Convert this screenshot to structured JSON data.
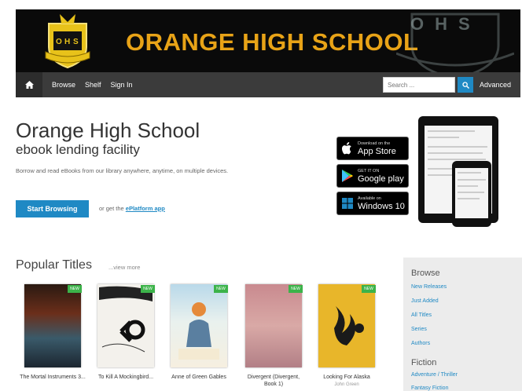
{
  "banner": {
    "title": "ORANGE HIGH SCHOOL",
    "watermark": "OHS",
    "crest_letters": [
      "O",
      "H",
      "S"
    ]
  },
  "nav": {
    "items": [
      "Browse",
      "Shelf",
      "Sign In"
    ],
    "search_placeholder": "Search ...",
    "advanced": "Advanced"
  },
  "hero": {
    "title": "Orange High School",
    "subtitle": "ebook lending facility",
    "description": "Borrow and read eBooks from our library anywhere, anytime, on multiple devices.",
    "button": "Start Browsing",
    "or_get_prefix": "or get the",
    "or_get_link": "ePlatform app"
  },
  "badges": [
    {
      "small": "Download on the",
      "large": "App Store",
      "icon": "apple-icon"
    },
    {
      "small": "GET IT ON",
      "large": "Google play",
      "icon": "google-play-icon"
    },
    {
      "small": "Available on",
      "large": "Windows 10",
      "icon": "windows-icon"
    }
  ],
  "popular": {
    "heading": "Popular Titles",
    "view_more": "...view more",
    "new_label": "NEW",
    "books": [
      {
        "title": "The Mortal Instruments 3...",
        "author": ""
      },
      {
        "title": "To Kill A Mockingbird...",
        "author": ""
      },
      {
        "title": "Anne of Green Gables",
        "author": ""
      },
      {
        "title": "Divergent (Divergent, Book 1)",
        "author": ""
      },
      {
        "title": "Looking For Alaska",
        "author": "John Green"
      }
    ]
  },
  "sidebar": {
    "browse_heading": "Browse",
    "browse_links": [
      "New Releases",
      "Just Added",
      "All Titles",
      "Series",
      "Authors"
    ],
    "fiction_heading": "Fiction",
    "fiction_links": [
      "Adventure / Thriller",
      "Fantasy Fiction"
    ]
  },
  "colors": {
    "accent": "#1f89c4",
    "banner_gold": "#e8a317",
    "new_badge": "#3cb34a"
  }
}
